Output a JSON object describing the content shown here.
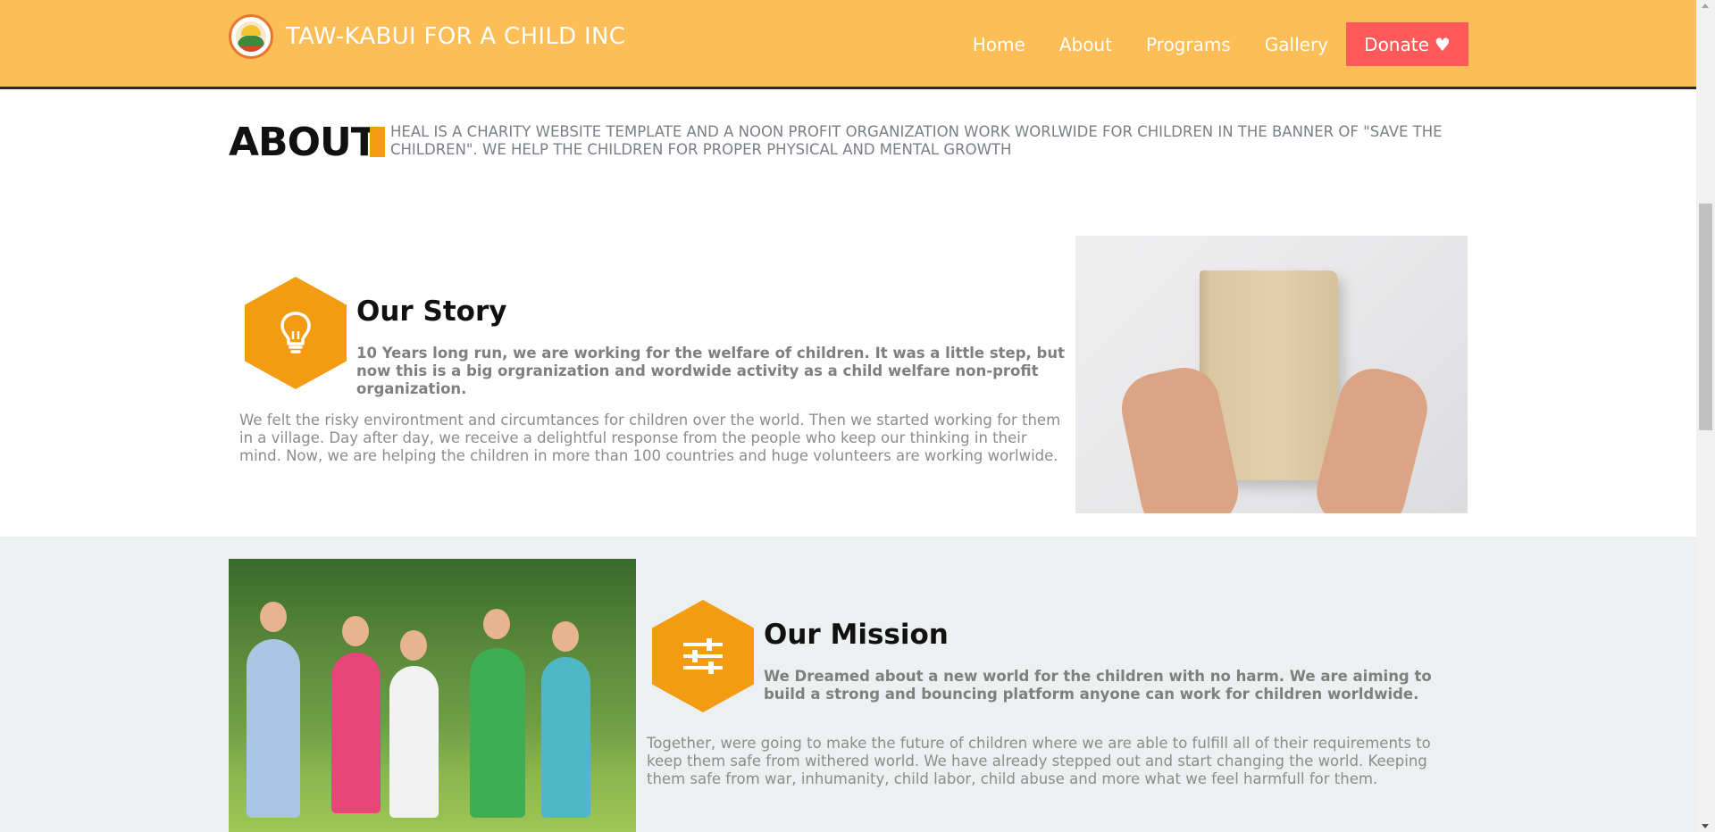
{
  "header": {
    "brand": "TAW-KABUI FOR A CHILD INC",
    "nav": [
      "Home",
      "About",
      "Programs",
      "Gallery"
    ],
    "donate_label": "Donate",
    "donate_icon": "♥",
    "bg_color": "#fdbd57",
    "donate_color": "#fe5a5a"
  },
  "about": {
    "title": "ABOUT",
    "description": "HEAL IS A CHARITY WEBSITE TEMPLATE AND A NOON PROFIT ORGANIZATION WORK WORLWIDE FOR CHILDREN IN THE BANNER OF \"SAVE THE CHILDREN\". WE HELP THE CHILDREN FOR PROPER PHYSICAL AND MENTAL GROWTH",
    "accent_color": "#f39c12"
  },
  "story": {
    "title": "Our Story",
    "icon": "lightbulb-icon",
    "lead": "10 Years long run, we are working for the welfare of children. It was a little step, but now this is a big orgranization and wordwide activity as a child welfare non-profit organization.",
    "body": "We felt the risky environtment and circumtances for children over the world. Then we started working for them in a village. Day after day, we receive a delightful response from the people who keep our thinking in their mind. Now, we are helping the children in more than 100 countries and huge volunteers are working worlwide."
  },
  "mission": {
    "title": "Our Mission",
    "icon": "sliders-icon",
    "lead": "We Dreamed about a new world for the children with no harm. We are aiming to build a strong and bouncing platform anyone can work for children worldwide.",
    "body": "Together, were going to make the future of children where we are able to fulfill all of their requirements to keep them safe from withered world. We have already stepped out and start changing the world. Keeping them safe from war, inhumanity, child labor, child abuse and more what we feel harmfull for them.",
    "section_bg": "#ecf0f1"
  }
}
